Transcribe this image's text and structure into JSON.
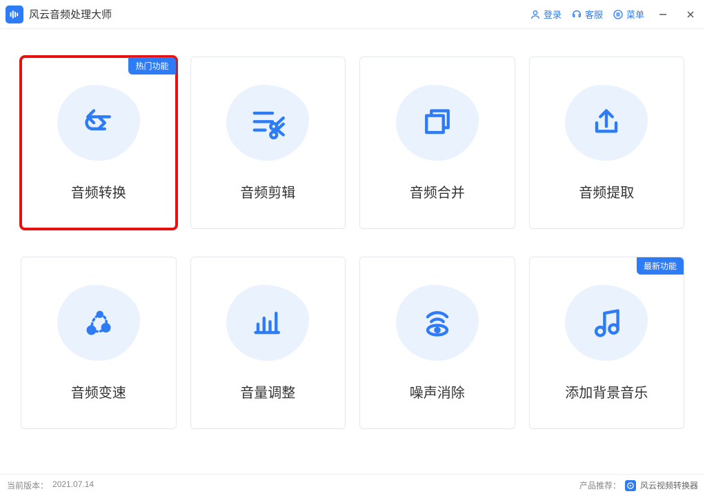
{
  "app": {
    "title": "风云音频处理大师"
  },
  "titlebar": {
    "login": "登录",
    "service": "客服",
    "menu": "菜单"
  },
  "cards": [
    {
      "label": "音频转换",
      "badge": "热门功能"
    },
    {
      "label": "音频剪辑"
    },
    {
      "label": "音频合并"
    },
    {
      "label": "音频提取"
    },
    {
      "label": "音频变速"
    },
    {
      "label": "音量调整"
    },
    {
      "label": "噪声消除"
    },
    {
      "label": "添加背景音乐",
      "badge": "最新功能"
    }
  ],
  "status": {
    "version_label": "当前版本：",
    "version_value": "2021.07.14",
    "recommend_label": "产品推荐：",
    "recommend_value": "风云视频转换器"
  },
  "colors": {
    "primary": "#2e7bf6",
    "highlight": "#e91010"
  }
}
